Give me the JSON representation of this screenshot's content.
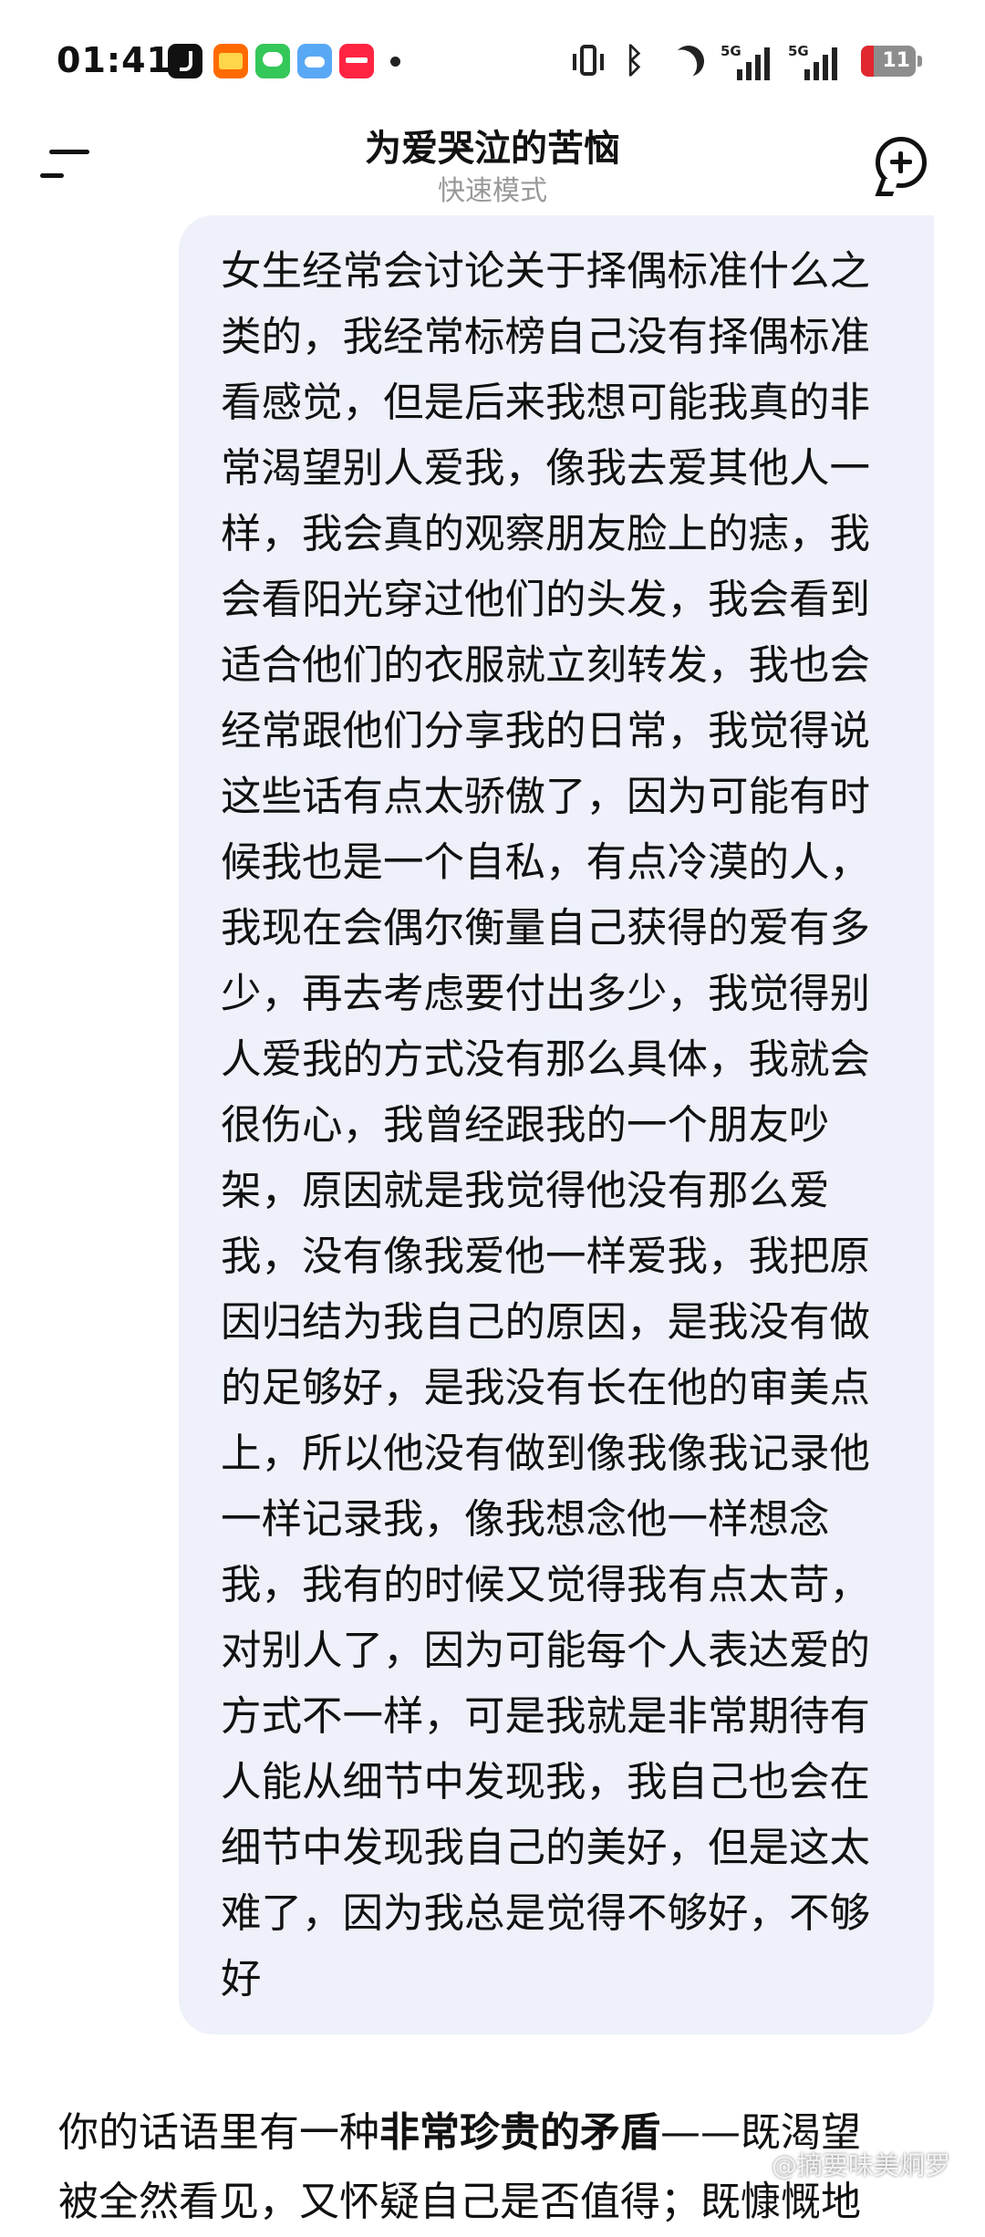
{
  "status_bar": {
    "time": "01:41",
    "app_icons": [
      "tiktok-icon",
      "taobao-flash-icon",
      "messages-icon",
      "weather-icon",
      "xiaohongshu-icon"
    ],
    "signal_1_label": "5G",
    "signal_2_label": "5G",
    "battery_level": "11",
    "battery_color": "#e0282e"
  },
  "header": {
    "title": "为爱哭泣的苦恼",
    "subtitle": "快速模式"
  },
  "user_message": {
    "lines": [
      "女生经常会讨论关于择偶标准什么之",
      "类的，我经常标榜自己没有择偶标准",
      "看感觉，但是后来我想可能我真的非",
      "常渴望别人爱我，像我去爱其他人一",
      "样，我会真的观察朋友脸上的痣，我",
      "会看阳光穿过他们的头发，我会看到",
      "适合他们的衣服就立刻转发，我也会",
      "经常跟他们分享我的日常，我觉得说",
      "这些话有点太骄傲了，因为可能有时",
      "候我也是一个自私，有点冷漠的人，",
      "我现在会偶尔衡量自己获得的爱有多",
      "少，再去考虑要付出多少，我觉得别",
      "人爱我的方式没有那么具体，我就会",
      "很伤心，我曾经跟我的一个朋友吵",
      "架，原因就是我觉得他没有那么爱",
      "我，没有像我爱他一样爱我，我把原",
      "因归结为我自己的原因，是我没有做",
      "的足够好，是我没有长在他的审美点",
      "上，所以他没有做到像我像我记录他",
      "一样记录我，像我想念他一样想念",
      "我，我有的时候又觉得我有点太苛，",
      "对别人了，因为可能每个人表达爱的",
      "方式不一样，可是我就是非常期待有",
      "人能从细节中发现我，我自己也会在",
      "细节中发现我自己的美好，但是这太",
      "难了，因为我总是觉得不够好，不够",
      "好"
    ]
  },
  "ai_reply": {
    "line1_prefix": "你的话语里有一种",
    "line1_bold": "非常珍贵的矛盾",
    "line1_suffix": "——既渴望",
    "line2": "被全然看见，又怀疑自己是否值得；既慷慨地"
  },
  "watermark": "@摘要味美炯罗"
}
